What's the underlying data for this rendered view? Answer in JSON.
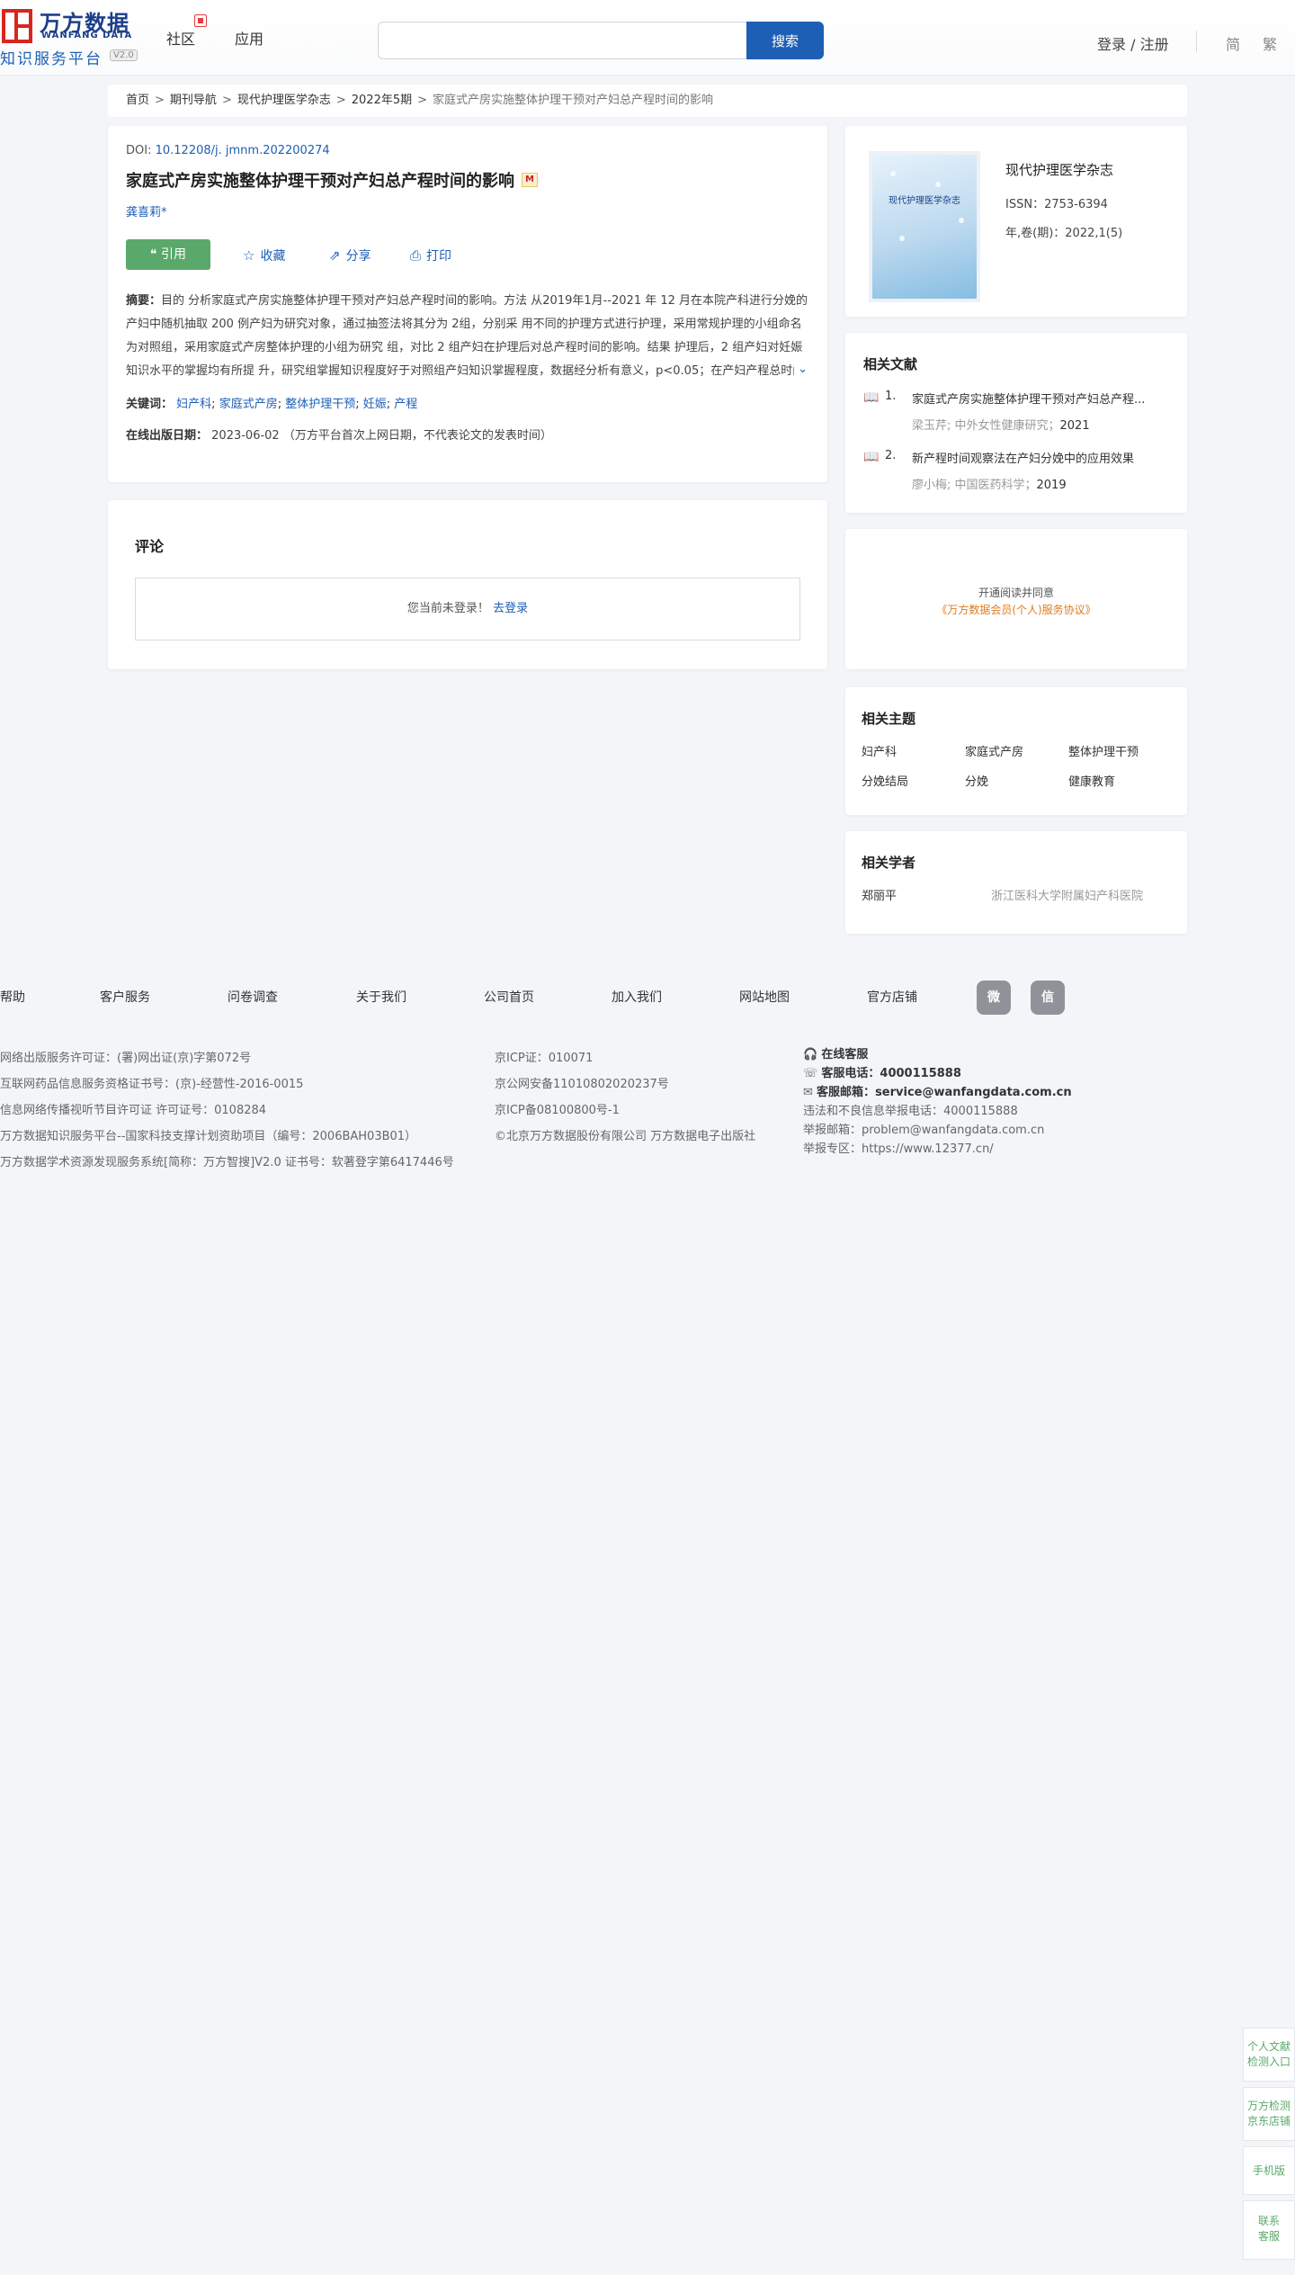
{
  "header": {
    "logo_cn": "万方数据",
    "logo_en": "WANFANG DATA",
    "logo_sub": "知识服务平台",
    "logo_version": "V2.0",
    "nav": [
      "社区",
      "应用"
    ],
    "search_placeholder": "",
    "search_button": "搜索",
    "login": "登录 / 注册",
    "lang_simplified": "简",
    "lang_traditional": "繁"
  },
  "breadcrumb": {
    "items": [
      "首页",
      "期刊导航",
      "现代护理医学杂志",
      "2022年5期"
    ],
    "current": "家庭式产房实施整体护理干预对产妇总产程时间的影响",
    "separator": ">"
  },
  "article": {
    "doi_label": "DOI:",
    "doi": "10.12208/j. jmnm.202200274",
    "title": "家庭式产房实施整体护理干预对产妇总产程时间的影响",
    "m_badge": "M",
    "author": "龚喜莉*",
    "cite_label": "引用",
    "favorite_label": "收藏",
    "share_label": "分享",
    "print_label": "打印",
    "abstract_label": "摘要：",
    "abstract": "目的 分析家庭式产房实施整体护理干预对产妇总产程时间的影响。方法 从2019年1月--2021 年 12 月在本院产科进行分娩的产妇中随机抽取 200 例产妇为研究对象，通过抽签法将其分为 2组，分别采 用不同的护理方式进行护理，采用常规护理的小组命名为对照组，采用家庭式产房整体护理的小组为研究 组，对比 2 组产妇在护理后对总产程时间的影响。结果 护理后，2 组产妇对妊娠知识水平的掌握均有所提 升，研究组掌握知识程度好于对照组产妇知识掌握程度，数据经分析有意义，p<0.05；在产妇产程总时间 方面，研究组产妇的总产程时间少于对照组产妇的总产程时间，数据经分析有意义...",
    "keywords_label": "关键词：",
    "keywords": [
      "妇产科",
      "家庭式产房",
      "整体护理干预",
      "妊娠",
      "产程"
    ],
    "pubdate_label": "在线出版日期：",
    "pubdate": "2023-06-02",
    "pubdate_note": "（万方平台首次上网日期，不代表论文的发表时间）"
  },
  "comments": {
    "title": "评论",
    "not_logged": "您当前未登录！",
    "login_link": "去登录"
  },
  "journal": {
    "cover_title": "现代护理医学杂志",
    "name": "现代护理医学杂志",
    "issn": "ISSN：2753-6394",
    "year_issue": "年,卷(期)：2022,1(5)"
  },
  "related_docs": {
    "title": "相关文献",
    "items": [
      {
        "num": "1.",
        "title": "家庭式产房实施整体护理干预对产妇总产程...",
        "authors": "梁玉芹; 中外女性健康研究；",
        "year": "2021"
      },
      {
        "num": "2.",
        "title": "新产程时间观察法在产妇分娩中的应用效果",
        "authors": "廖小梅; 中国医药科学；",
        "year": "2019"
      }
    ]
  },
  "agreement": {
    "line1": "开通阅读并同意",
    "line2": "《万方数据会员(个人)服务协议》"
  },
  "topics": {
    "title": "相关主题",
    "items": [
      "妇产科",
      "家庭式产房",
      "整体护理干预",
      "分娩结局",
      "分娩",
      "健康教育"
    ]
  },
  "scholars": {
    "title": "相关学者",
    "items": [
      {
        "name": "郑丽平",
        "org": "浙江医科大学附属妇产科医院"
      }
    ]
  },
  "footer": {
    "links": [
      "帮助",
      "客户服务",
      "问卷调查",
      "关于我们",
      "公司首页",
      "加入我们",
      "网站地图",
      "官方店铺"
    ],
    "social": [
      "weibo-icon",
      "wechat-icon"
    ],
    "col1": [
      "网络出版服务许可证：(署)网出证(京)字第072号",
      "互联网药品信息服务资格证书号：(京)-经营性-2016-0015",
      "信息网络传播视听节目许可证 许可证号：0108284",
      "万方数据知识服务平台--国家科技支撑计划资助项目（编号：2006BAH03B01）",
      "万方数据学术资源发现服务系统[简称：万方智搜]V2.0 证书号：软著登字第6417446号"
    ],
    "col2": [
      "京ICP证：010071",
      "京公网安备11010802020237号",
      "京ICP备08100800号-1",
      "©北京万方数据股份有限公司 万方数据电子出版社"
    ],
    "service_online": "在线客服",
    "service_phone_label": "客服电话：",
    "service_phone": "4000115888",
    "service_email_label": "客服邮箱：",
    "service_email": "service@wanfangdata.com.cn",
    "report_phone": "违法和不良信息举报电话：4000115888",
    "report_email": "举报邮箱：problem@wanfangdata.com.cn",
    "report_area": "举报专区：https://www.12377.cn/"
  },
  "float": [
    {
      "l1": "个人文献",
      "l2": "检测入口"
    },
    {
      "l1": "万方检测",
      "l2": "京东店铺"
    },
    {
      "l1": "手机版",
      "l2": ""
    },
    {
      "l1": "联系",
      "l2": "客服"
    }
  ]
}
